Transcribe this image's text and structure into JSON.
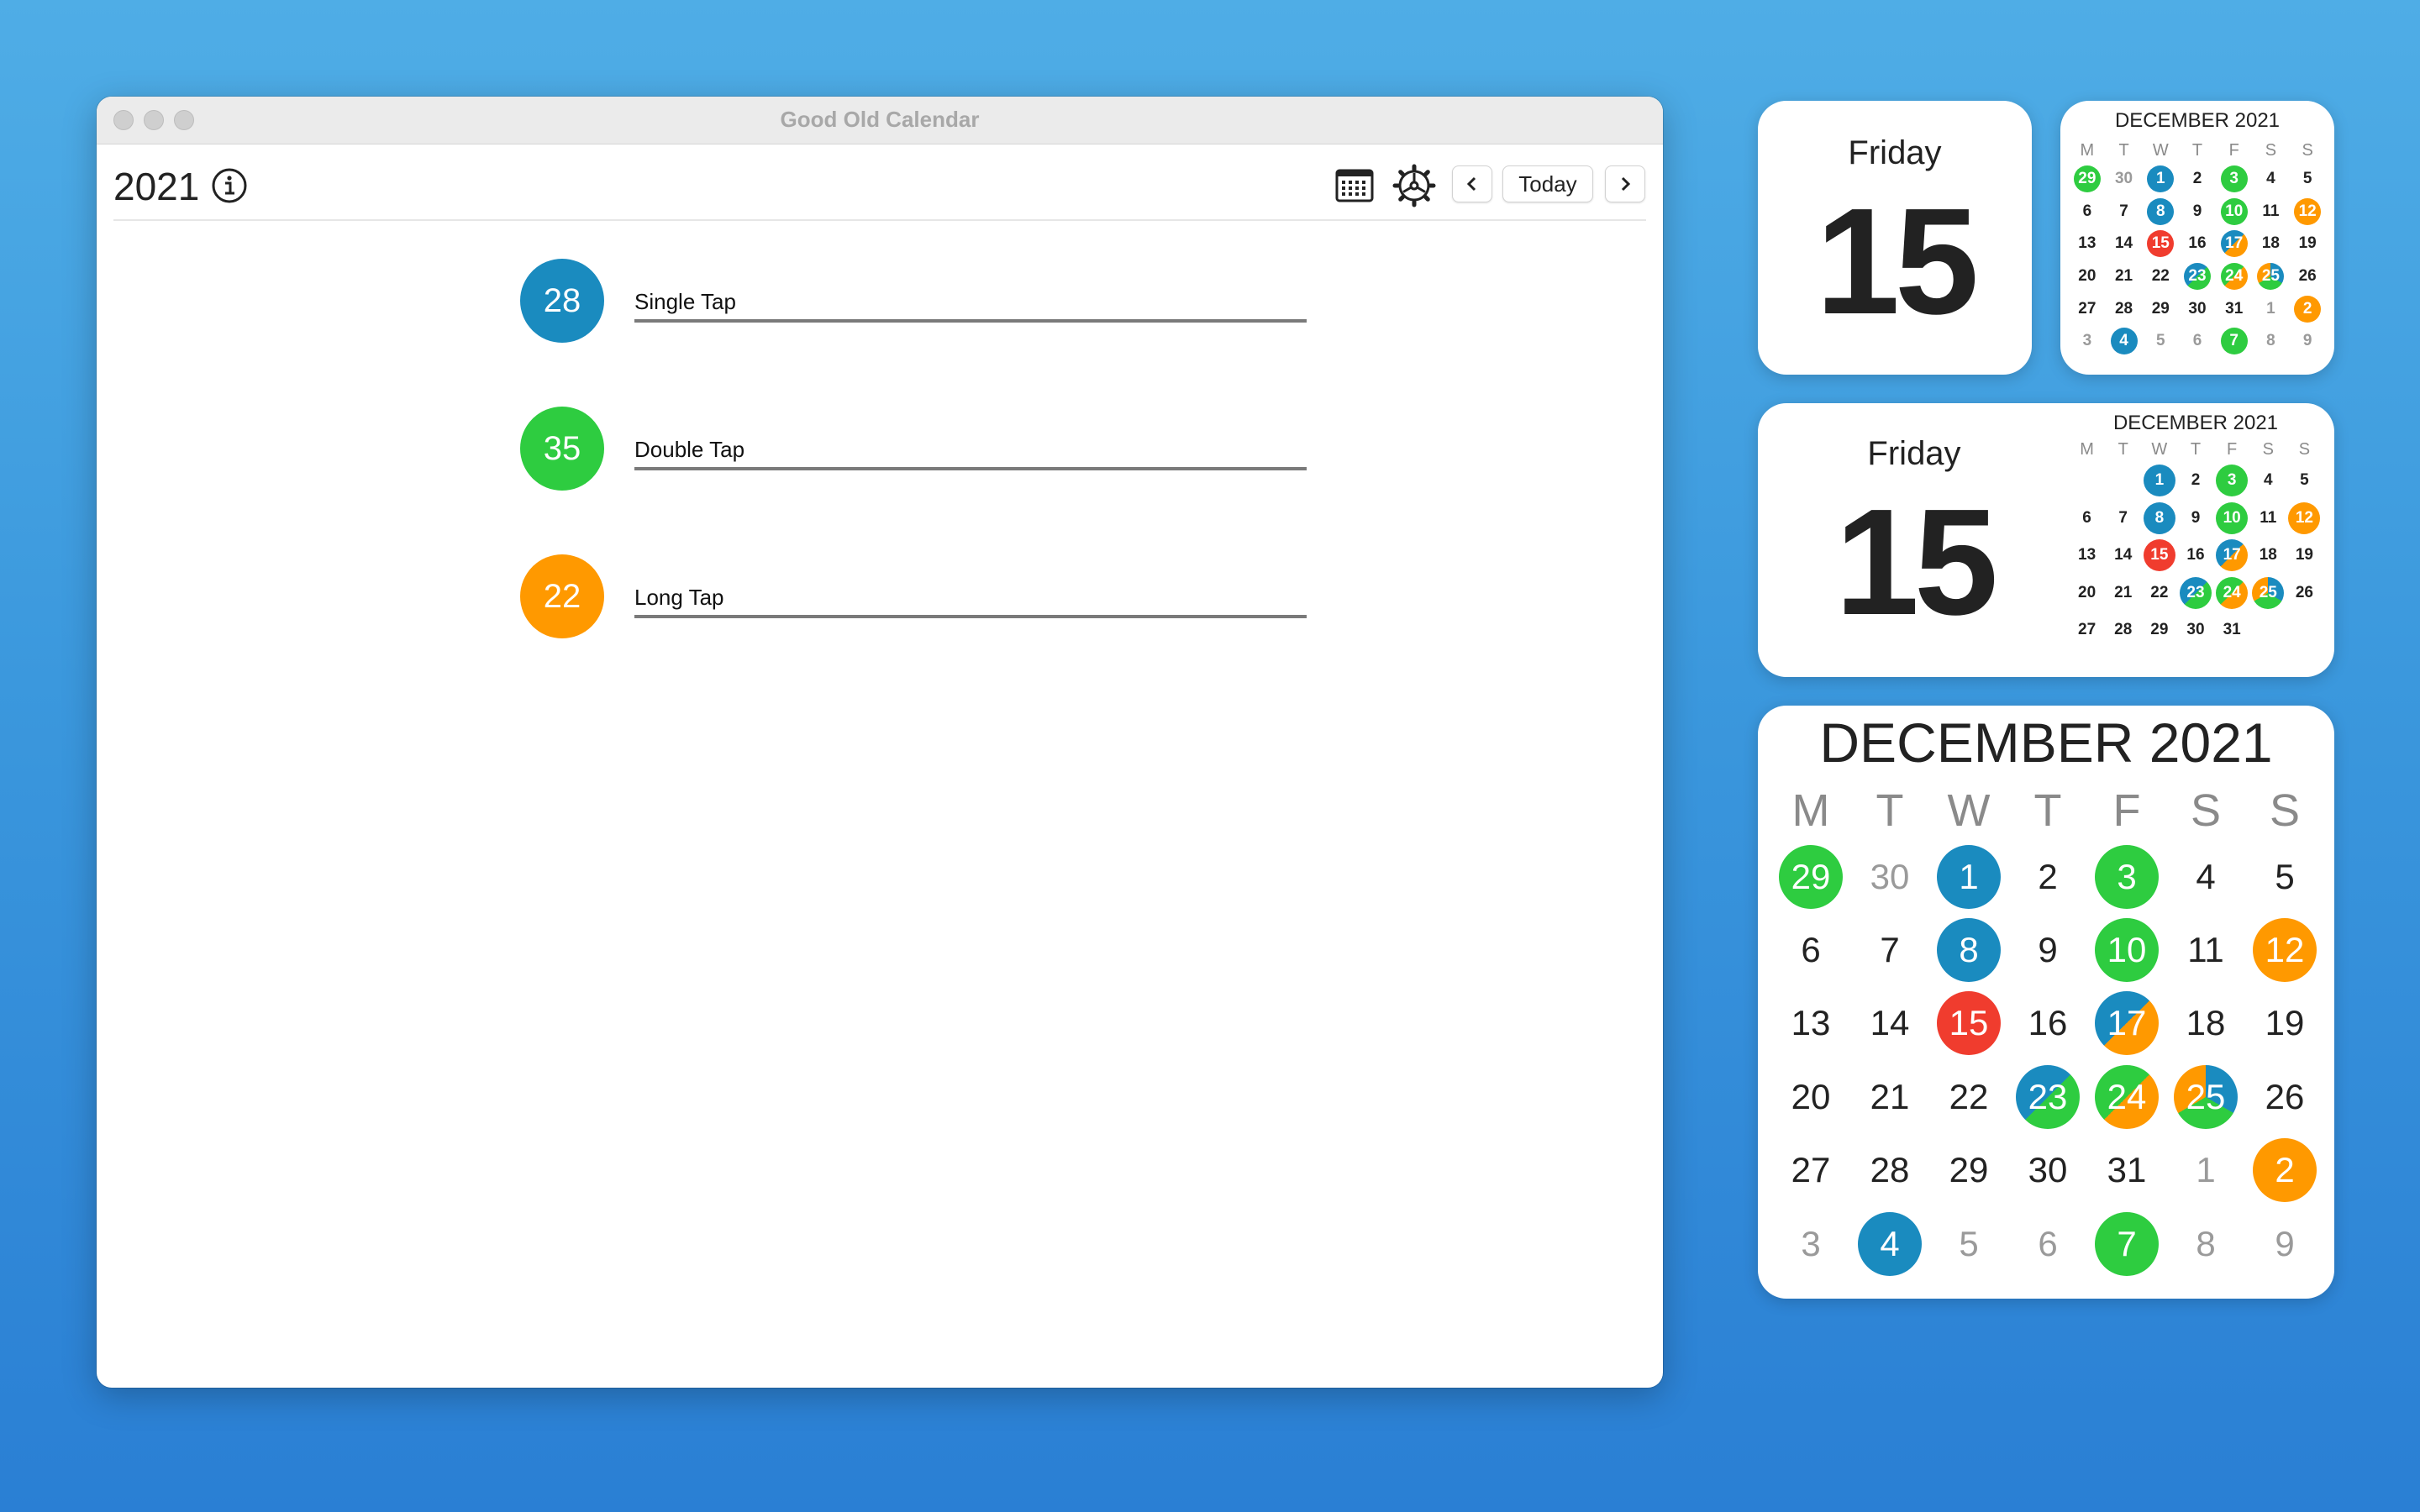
{
  "window": {
    "title": "Good Old Calendar",
    "year": "2021",
    "today_label": "Today"
  },
  "rows": [
    {
      "count": "28",
      "label": "Single Tap",
      "color": "#1a8bbf"
    },
    {
      "count": "35",
      "label": "Double Tap",
      "color": "#2ecc40"
    },
    {
      "count": "22",
      "label": "Long Tap",
      "color": "#ff9900"
    }
  ],
  "colors": {
    "blue": "#1a8bbf",
    "green": "#2ecc40",
    "orange": "#ff9900",
    "red": "#f03c2e"
  },
  "widgets": {
    "day_name": "Friday",
    "day_number": "15",
    "month_title": "DECEMBER 2021",
    "weekdays": [
      "M",
      "T",
      "W",
      "T",
      "F",
      "S",
      "S"
    ],
    "full_grid": [
      {
        "d": "29",
        "o": true,
        "c": [
          "green"
        ]
      },
      {
        "d": "30",
        "o": true,
        "c": []
      },
      {
        "d": "1",
        "c": [
          "blue"
        ]
      },
      {
        "d": "2",
        "c": []
      },
      {
        "d": "3",
        "c": [
          "green"
        ]
      },
      {
        "d": "4",
        "c": []
      },
      {
        "d": "5",
        "c": []
      },
      {
        "d": "6",
        "c": []
      },
      {
        "d": "7",
        "c": []
      },
      {
        "d": "8",
        "c": [
          "blue"
        ]
      },
      {
        "d": "9",
        "c": []
      },
      {
        "d": "10",
        "c": [
          "green"
        ]
      },
      {
        "d": "11",
        "c": []
      },
      {
        "d": "12",
        "c": [
          "orange"
        ]
      },
      {
        "d": "13",
        "c": []
      },
      {
        "d": "14",
        "c": []
      },
      {
        "d": "15",
        "c": [
          "red"
        ]
      },
      {
        "d": "16",
        "c": []
      },
      {
        "d": "17",
        "c": [
          "blue",
          "orange"
        ]
      },
      {
        "d": "18",
        "c": []
      },
      {
        "d": "19",
        "c": []
      },
      {
        "d": "20",
        "c": []
      },
      {
        "d": "21",
        "c": []
      },
      {
        "d": "22",
        "c": []
      },
      {
        "d": "23",
        "c": [
          "blue",
          "green"
        ]
      },
      {
        "d": "24",
        "c": [
          "green",
          "orange"
        ]
      },
      {
        "d": "25",
        "c": [
          "blue",
          "green",
          "orange"
        ]
      },
      {
        "d": "26",
        "c": []
      },
      {
        "d": "27",
        "c": []
      },
      {
        "d": "28",
        "c": []
      },
      {
        "d": "29",
        "c": []
      },
      {
        "d": "30",
        "c": []
      },
      {
        "d": "31",
        "c": []
      },
      {
        "d": "1",
        "o": true,
        "c": []
      },
      {
        "d": "2",
        "o": true,
        "c": [
          "orange"
        ]
      },
      {
        "d": "3",
        "o": true,
        "c": []
      },
      {
        "d": "4",
        "o": true,
        "c": [
          "blue"
        ]
      },
      {
        "d": "5",
        "o": true,
        "c": []
      },
      {
        "d": "6",
        "o": true,
        "c": []
      },
      {
        "d": "7",
        "o": true,
        "c": [
          "green"
        ]
      },
      {
        "d": "8",
        "o": true,
        "c": []
      },
      {
        "d": "9",
        "o": true,
        "c": []
      }
    ],
    "medium_grid": [
      {
        "d": "",
        "c": []
      },
      {
        "d": "",
        "c": []
      },
      {
        "d": "1",
        "c": [
          "blue"
        ]
      },
      {
        "d": "2",
        "c": []
      },
      {
        "d": "3",
        "c": [
          "green"
        ]
      },
      {
        "d": "4",
        "c": []
      },
      {
        "d": "5",
        "c": []
      },
      {
        "d": "6",
        "c": []
      },
      {
        "d": "7",
        "c": []
      },
      {
        "d": "8",
        "c": [
          "blue"
        ]
      },
      {
        "d": "9",
        "c": []
      },
      {
        "d": "10",
        "c": [
          "green"
        ]
      },
      {
        "d": "11",
        "c": []
      },
      {
        "d": "12",
        "c": [
          "orange"
        ]
      },
      {
        "d": "13",
        "c": []
      },
      {
        "d": "14",
        "c": []
      },
      {
        "d": "15",
        "c": [
          "red"
        ]
      },
      {
        "d": "16",
        "c": []
      },
      {
        "d": "17",
        "c": [
          "blue",
          "orange"
        ]
      },
      {
        "d": "18",
        "c": []
      },
      {
        "d": "19",
        "c": []
      },
      {
        "d": "20",
        "c": []
      },
      {
        "d": "21",
        "c": []
      },
      {
        "d": "22",
        "c": []
      },
      {
        "d": "23",
        "c": [
          "blue",
          "green"
        ]
      },
      {
        "d": "24",
        "c": [
          "green",
          "orange"
        ]
      },
      {
        "d": "25",
        "c": [
          "blue",
          "green",
          "orange"
        ]
      },
      {
        "d": "26",
        "c": []
      },
      {
        "d": "27",
        "c": []
      },
      {
        "d": "28",
        "c": []
      },
      {
        "d": "29",
        "c": []
      },
      {
        "d": "30",
        "c": []
      },
      {
        "d": "31",
        "c": []
      }
    ]
  }
}
